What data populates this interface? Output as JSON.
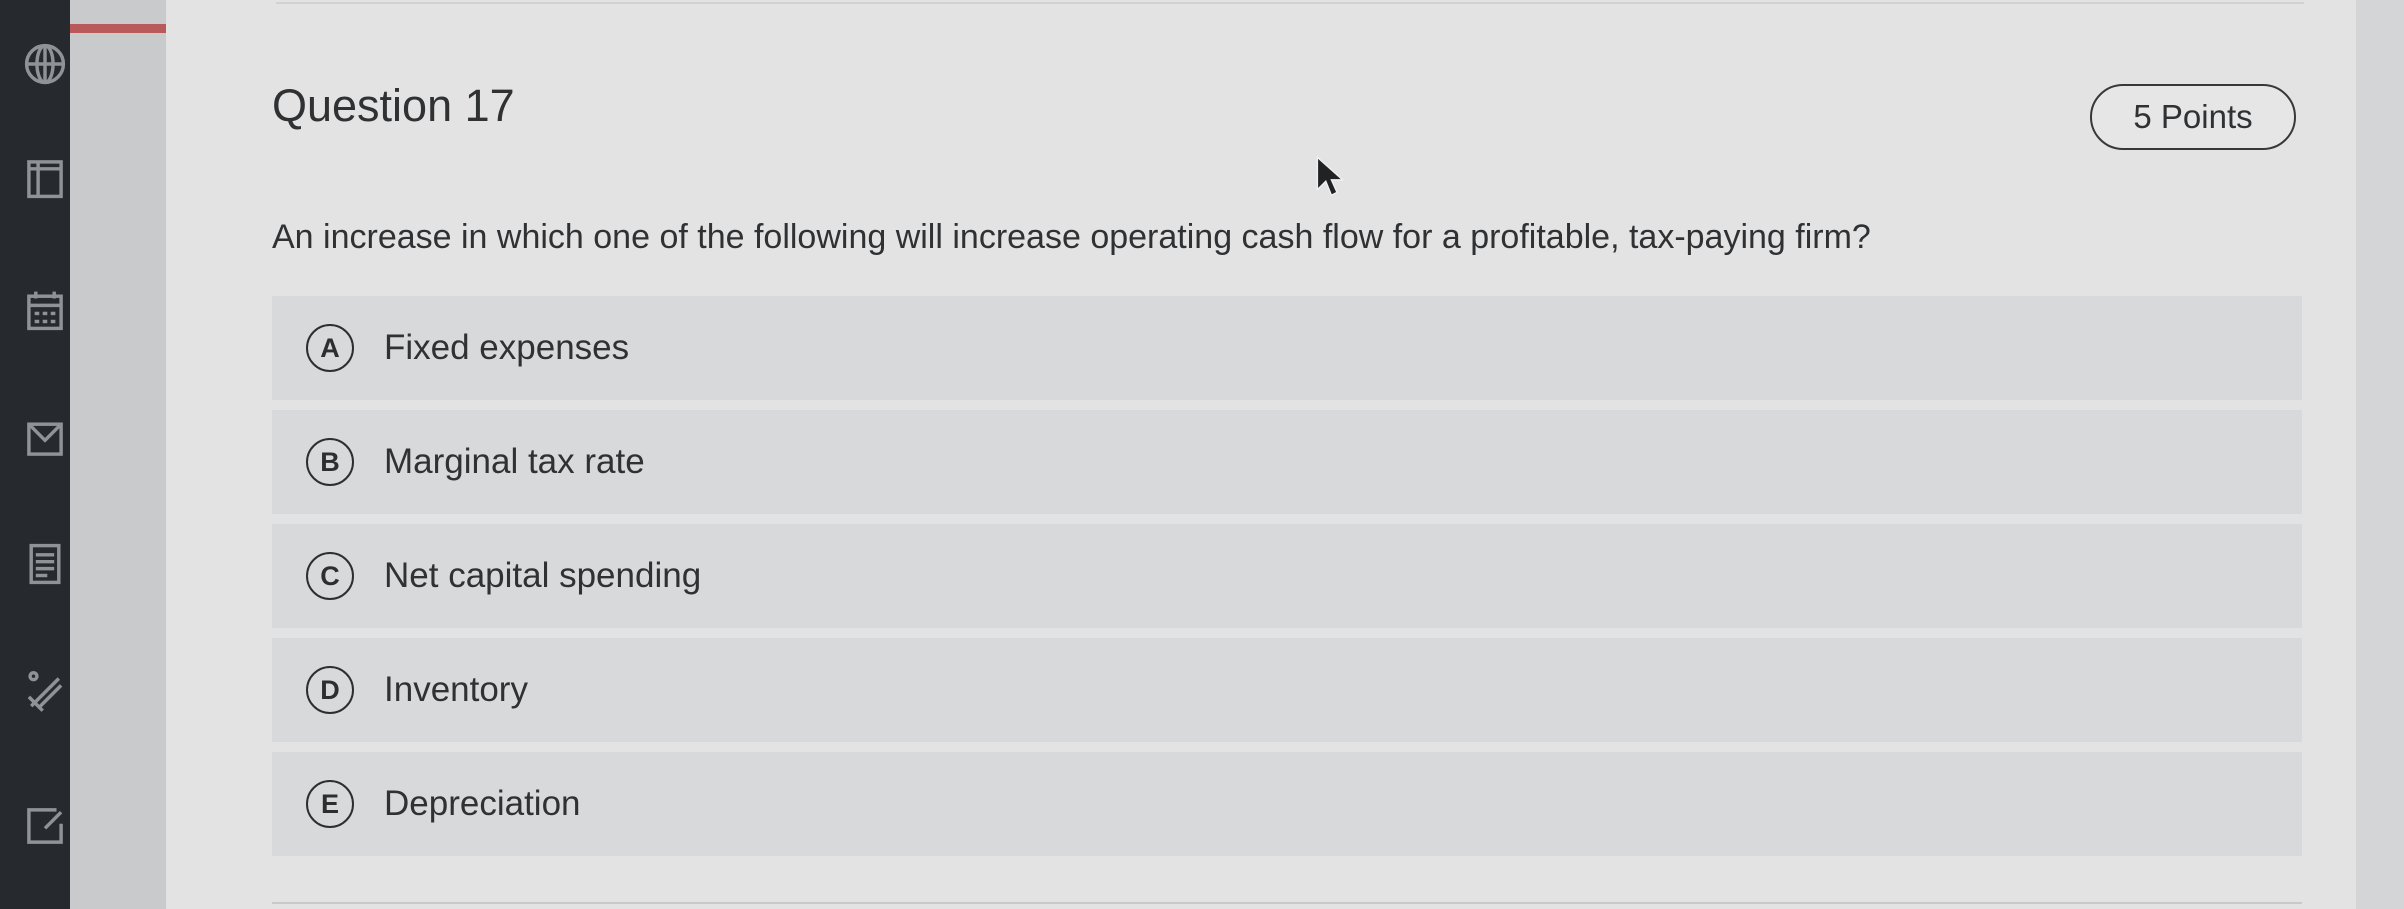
{
  "question": {
    "title": "Question 17",
    "points": "5 Points",
    "text": "An increase in which one of the following will increase operating cash flow for a profitable, tax-paying firm?"
  },
  "options": [
    {
      "letter": "A",
      "label": "Fixed expenses"
    },
    {
      "letter": "B",
      "label": "Marginal tax rate"
    },
    {
      "letter": "C",
      "label": "Net capital spending"
    },
    {
      "letter": "D",
      "label": "Inventory"
    },
    {
      "letter": "E",
      "label": "Depreciation"
    }
  ],
  "sidebar": {
    "icons": [
      "globe-icon",
      "book-icon",
      "calendar-icon",
      "inbox-icon",
      "notes-icon",
      "tools-icon",
      "edit-icon"
    ]
  },
  "colors": {
    "rail": "#26292d",
    "card": "#e3e3e4",
    "option_bg": "#d8d9da",
    "accent": "#b85a5a"
  }
}
